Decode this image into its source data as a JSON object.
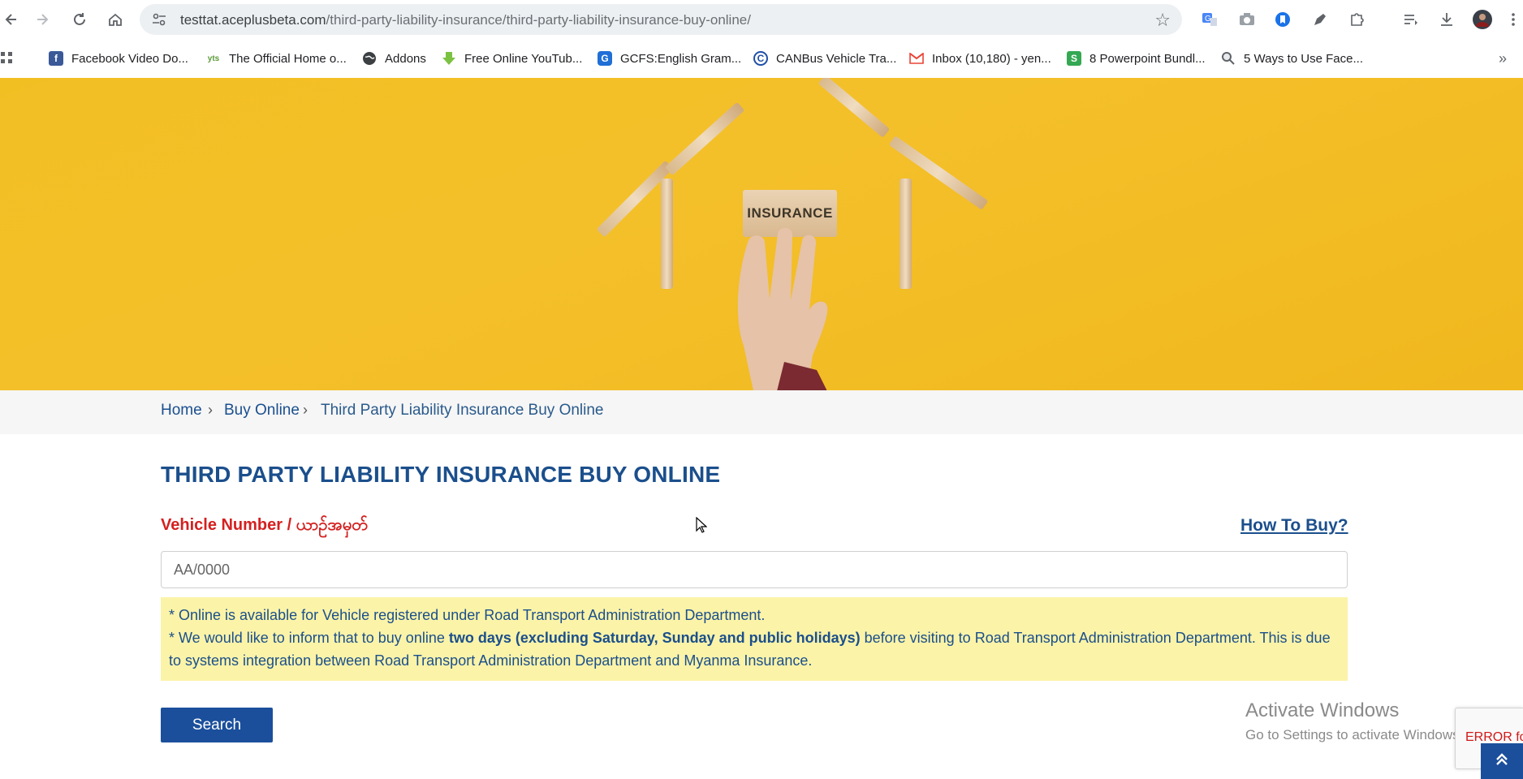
{
  "browser": {
    "url_host": "testtat.aceplusbeta.com",
    "url_path": "/third-party-liability-insurance/third-party-liability-insurance-buy-online/",
    "icons": [
      "back-icon",
      "forward-icon",
      "reload-icon",
      "home-icon",
      "site-info-icon",
      "bookmark-star-icon"
    ]
  },
  "bookmarks": [
    {
      "label": "Facebook Video Do...",
      "icon": "facebook-icon"
    },
    {
      "label": "The Official Home o...",
      "icon": "yts-icon"
    },
    {
      "label": "Addons",
      "icon": "globe-icon"
    },
    {
      "label": "Free Online YouTub...",
      "icon": "download-arrow-icon"
    },
    {
      "label": "GCFS:English Gram...",
      "icon": "gcfs-icon"
    },
    {
      "label": "CANBus Vehicle Tra...",
      "icon": "c-logo-icon"
    },
    {
      "label": "Inbox (10,180) - yen...",
      "icon": "gmail-icon"
    },
    {
      "label": "8 Powerpoint Bundl...",
      "icon": "green-s-icon"
    },
    {
      "label": "5 Ways to Use Face...",
      "icon": "magnifier-icon"
    }
  ],
  "hero": {
    "block_text": "INSURANCE"
  },
  "breadcrumb": {
    "home": "Home",
    "buy_online": "Buy Online",
    "current": "Third Party Liability Insurance Buy Online"
  },
  "page": {
    "title": "THIRD PARTY LIABILITY INSURANCE BUY ONLINE",
    "field_label": "Vehicle Number / ယာဥ်အမှတ်",
    "how_to_buy": "How To Buy?",
    "vehicle_placeholder": "AA/0000",
    "vehicle_value": "",
    "notice_line1": "* Online is available for Vehicle registered under Road Transport Administration Department.",
    "notice_line2_pre": "* We would like to inform that to buy online ",
    "notice_line2_bold": "two days (excluding Saturday, Sunday and public holidays)",
    "notice_line2_post": " before visiting to Road Transport Administration Department. This is due to systems integration between Road Transport Administration Department and Myanma Insurance.",
    "search_label": "Search"
  },
  "overlays": {
    "activate_title": "Activate Windows",
    "activate_sub": "Go to Settings to activate Windows.",
    "recaptcha_error": "ERROR for site owner: Invalid key type"
  },
  "colors": {
    "brand_blue": "#1b4f9c",
    "label_red": "#d42020",
    "notice_bg": "#fbf3a8",
    "hero_yellow": "#f2bf23"
  }
}
